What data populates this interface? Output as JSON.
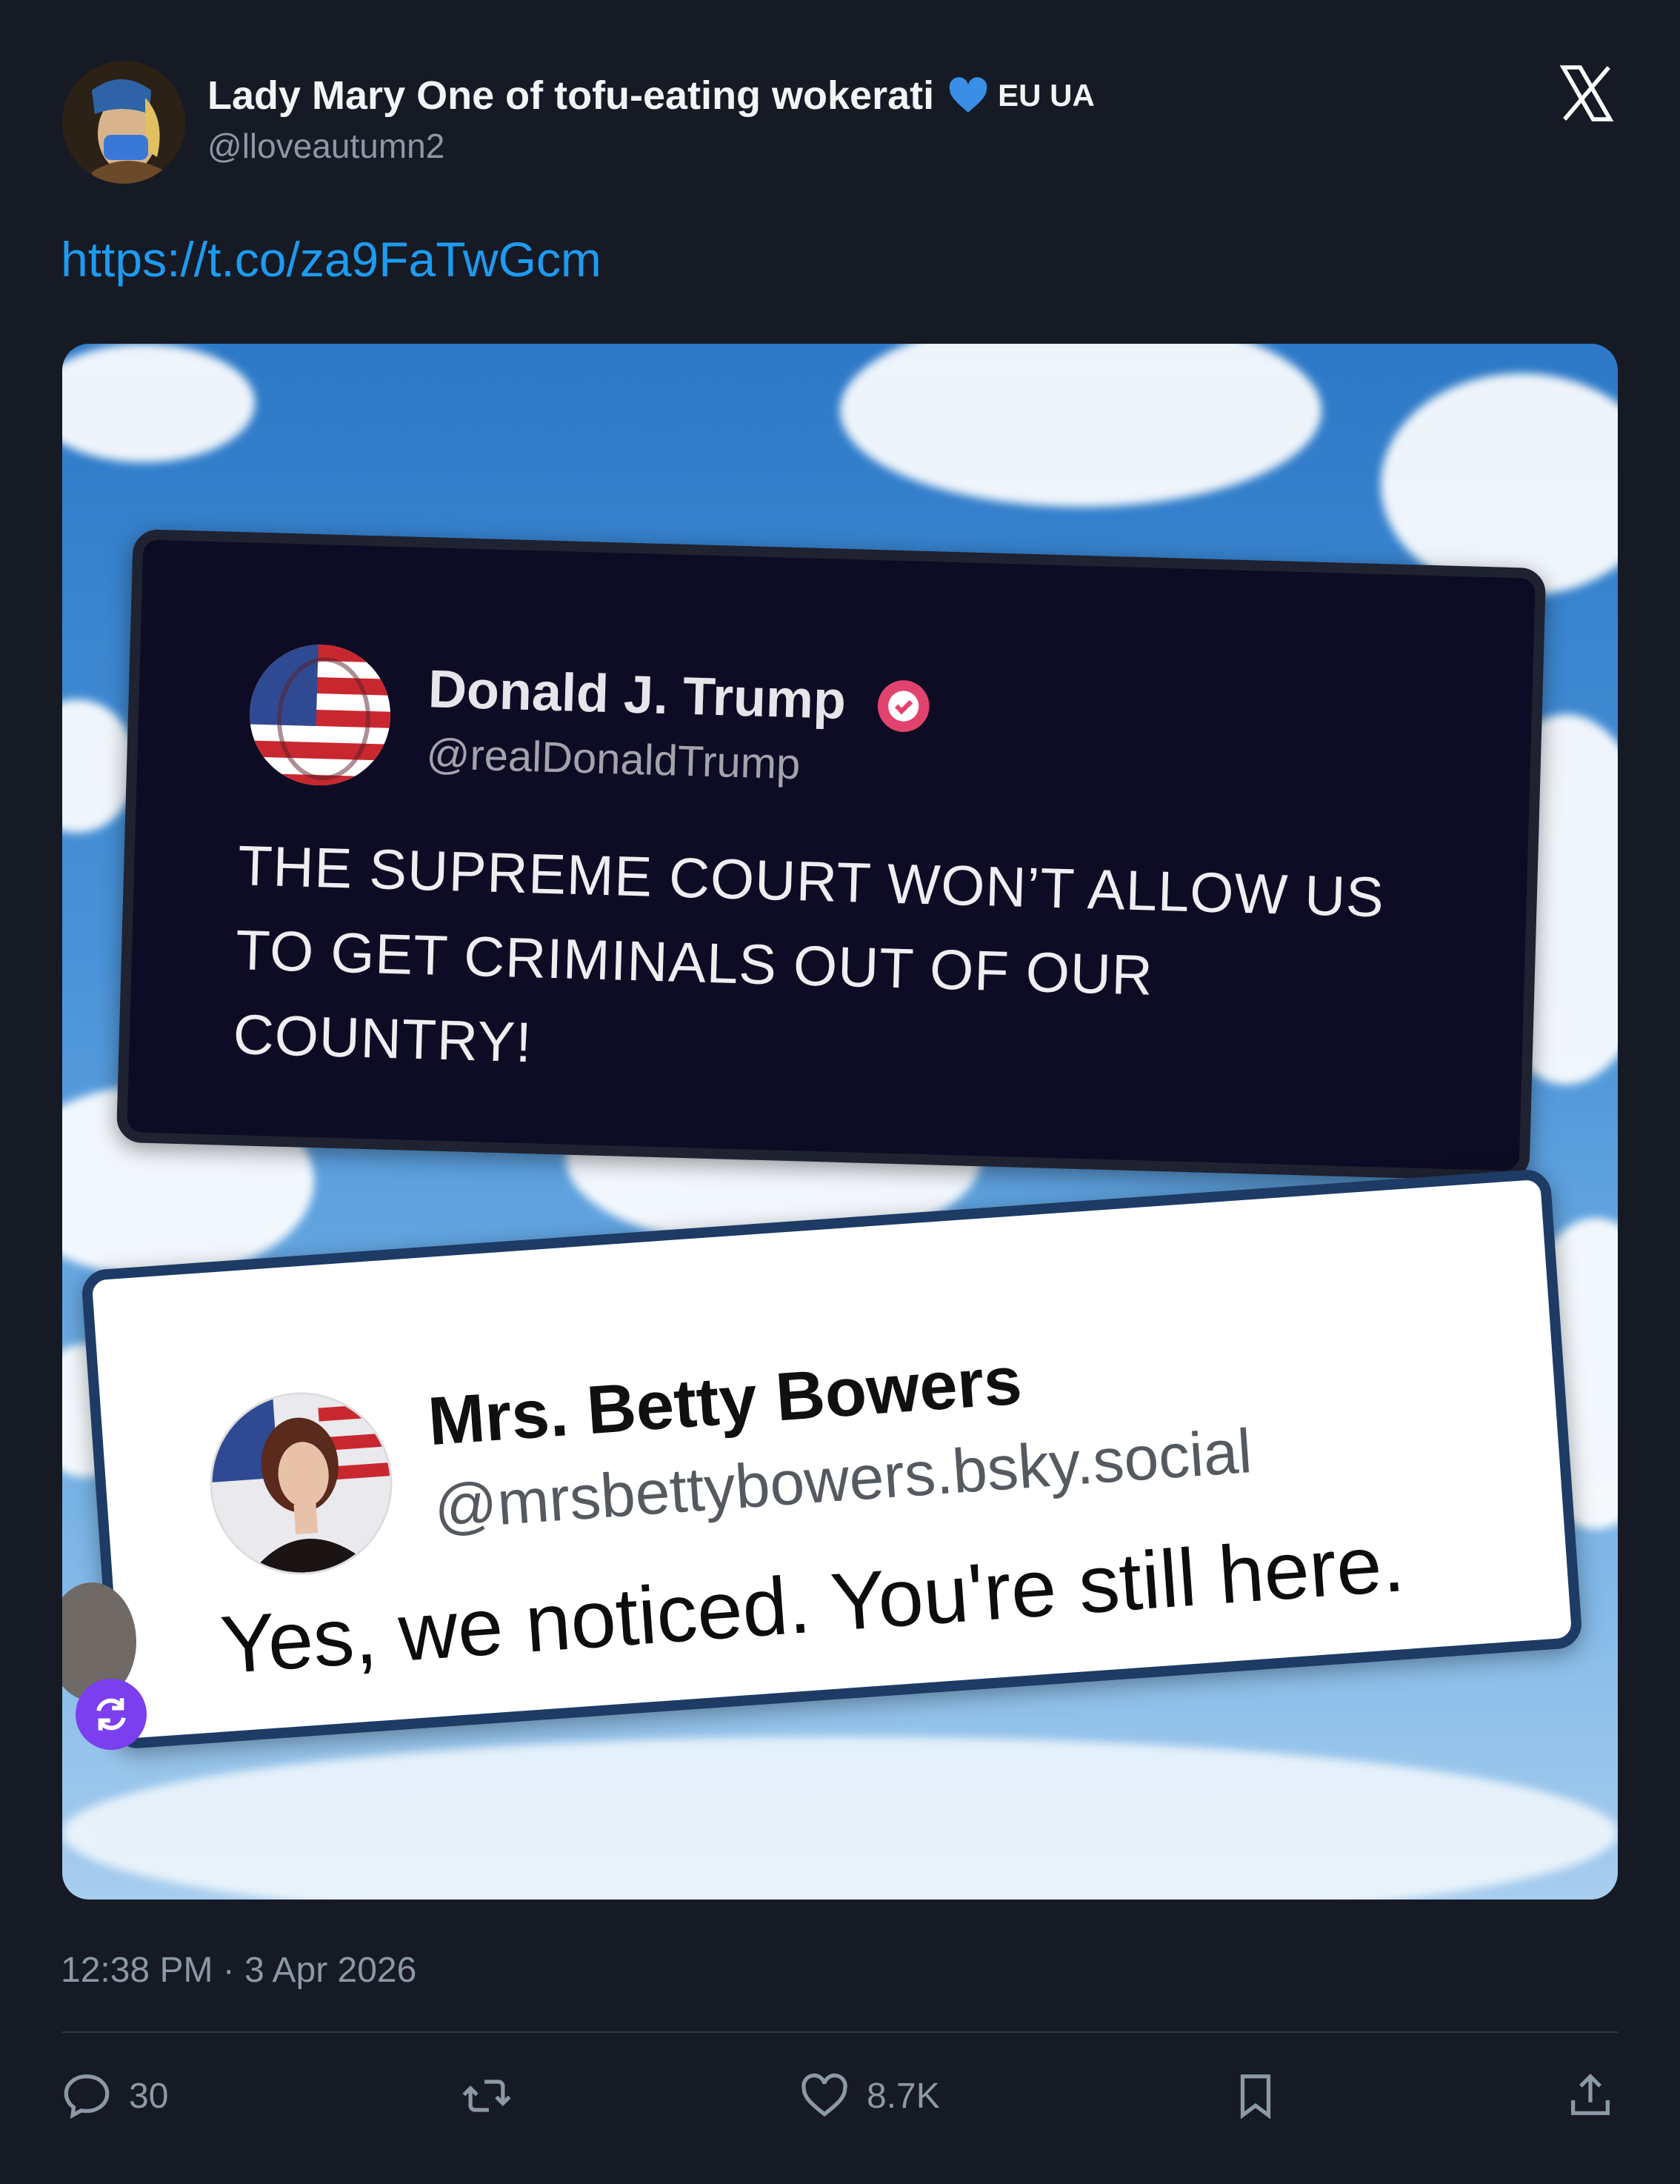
{
  "author": {
    "display_name": "Lady Mary One of tofu-eating wokerati",
    "flags_text": "EU UA",
    "handle": "@lloveautumn2"
  },
  "tweet": {
    "link_text": "https://t.co/za9FaTwGcm",
    "timestamp": "12:38 PM · 3 Apr 2026"
  },
  "media": {
    "trump_post": {
      "name": "Donald J. Trump",
      "handle": "@realDonaldTrump",
      "text": "THE SUPREME COURT WON’T ALLOW US TO GET CRIMINALS OUT OF OUR COUNTRY!"
    },
    "betty_post": {
      "name": "Mrs. Betty Bowers",
      "handle": "@mrsbettybowers.bsky.social",
      "text": "Yes, we noticed. You're still here."
    }
  },
  "actions": {
    "replies": "30",
    "likes": "8.7K"
  },
  "colors": {
    "link": "#1d9bf0",
    "background": "#161a25",
    "muted": "#8b98a5",
    "verified_badge": "#e2436e",
    "repost_badge": "#7b3ff0"
  },
  "icons": [
    "heart-icon",
    "close-icon",
    "verified-badge-icon",
    "repost-icon",
    "reply-icon",
    "retweet-icon",
    "like-icon",
    "bookmark-icon",
    "share-icon"
  ]
}
